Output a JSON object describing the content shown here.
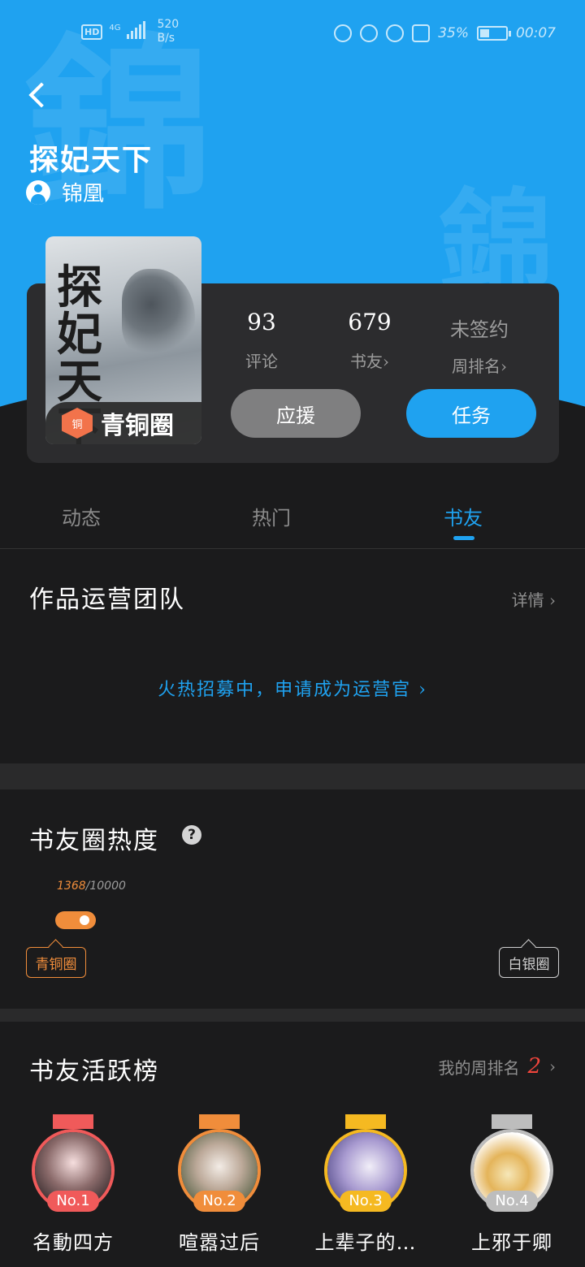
{
  "status_bar": {
    "hd": "HD",
    "network": "4G",
    "speed_value": "520",
    "speed_unit": "B/s",
    "battery": "35%",
    "time": "00:07",
    "battery_level": 0.35
  },
  "hero": {
    "watermark_char": "錦",
    "title": "探妃天下",
    "author": "锦凰",
    "accent_color": "#1fa2f0"
  },
  "card": {
    "cover_calligraphy": "探妃天下",
    "tier_icon": "铜",
    "tier_label": "青铜圈",
    "stats": [
      {
        "value": "93",
        "label": "评论"
      },
      {
        "value": "679",
        "label": "书友›"
      },
      {
        "value": "未签约",
        "label": "周排名›"
      }
    ],
    "support_button": "应援",
    "task_button": "任务"
  },
  "tabs": [
    {
      "label": "动态",
      "active": false
    },
    {
      "label": "热门",
      "active": false
    },
    {
      "label": "书友",
      "active": true
    }
  ],
  "ops_team": {
    "title": "作品运营团队",
    "detail": "详情 ›",
    "recruit": "火热招募中，申请成为运营官 ›"
  },
  "heat": {
    "title": "书友圈热度",
    "help": "?",
    "current": "1368",
    "max": "/10000",
    "progress": 0.1368,
    "current_tier": "青铜圈",
    "next_tier": "白银圈"
  },
  "activity": {
    "title": "书友活跃榜",
    "my_rank_label": "我的周排名",
    "my_rank_value": "2",
    "members": [
      {
        "rank": "No.1",
        "name": "名動四方",
        "color": "#f05a5a"
      },
      {
        "rank": "No.2",
        "name": "喧嚣过后",
        "color": "#f08d3b"
      },
      {
        "rank": "No.3",
        "name": "上辈子的…",
        "color": "#f5b921"
      },
      {
        "rank": "No.4",
        "name": "上邪于卿",
        "color": "#bdbdbd"
      }
    ]
  }
}
